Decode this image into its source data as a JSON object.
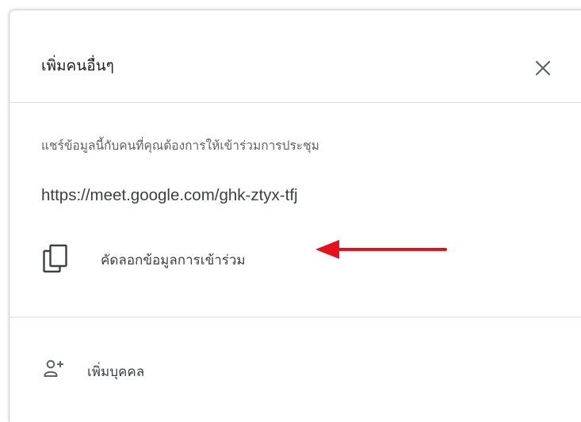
{
  "dialog": {
    "title": "เพิ่มคนอื่นๆ",
    "close_icon": "close-icon",
    "description": "แชร์ข้อมูลนี้กับคนที่คุณต้องการให้เข้าร่วมการประชุม",
    "meeting_link": "https://meet.google.com/ghk-ztyx-tfj",
    "copy_action": {
      "icon": "copy-icon",
      "label": "คัดลอกข้อมูลการเข้าร่วม"
    },
    "annotation_arrow": {
      "color": "#e8101a"
    },
    "add_people": {
      "icon": "person-add-icon",
      "label": "เพิ่มบุคคล"
    }
  }
}
